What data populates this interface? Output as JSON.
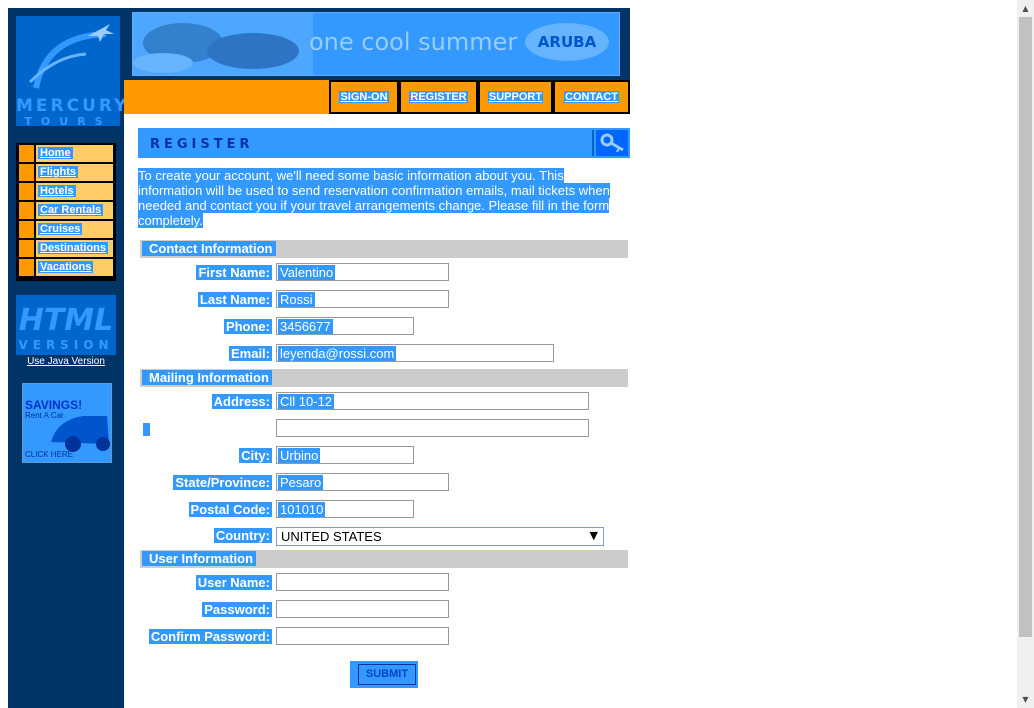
{
  "logo": {
    "line1": "MERCURY",
    "line2": "TOURS"
  },
  "nav": [
    {
      "label": "Home"
    },
    {
      "label": "Flights"
    },
    {
      "label": "Hotels"
    },
    {
      "label": "Car Rentals"
    },
    {
      "label": "Cruises"
    },
    {
      "label": "Destinations"
    },
    {
      "label": "Vacations"
    }
  ],
  "html_version": {
    "big": "HTML",
    "small": "VERSION",
    "link": "Use Java Version"
  },
  "ad": {
    "title": "SAVINGS!",
    "sub": "Rent A Car",
    "cta": "CLICK HERE"
  },
  "banner": {
    "slogan": "one cool summer",
    "brand": "ARUBA"
  },
  "top_nav": [
    {
      "label": "SIGN-ON"
    },
    {
      "label": "REGISTER"
    },
    {
      "label": "SUPPORT"
    },
    {
      "label": "CONTACT"
    }
  ],
  "page_title": "REGISTER",
  "intro": "To create your account, we'll need some basic information about you. This information will be used to send reservation confirmation emails, mail tickets when needed and contact you if your travel arrangements change. Please fill in the form completely.",
  "sections": {
    "contact": "Contact Information",
    "mailing": "Mailing Information",
    "user": "User Information"
  },
  "fields": {
    "first_name": {
      "label": "First Name:",
      "value": "Valentino"
    },
    "last_name": {
      "label": "Last Name:",
      "value": "Rossi"
    },
    "phone": {
      "label": "Phone:",
      "value": "3456677"
    },
    "email": {
      "label": "Email:",
      "value": "leyenda@rossi.com"
    },
    "address": {
      "label": "Address:",
      "value": "Cll 10-12"
    },
    "address2": {
      "value": ""
    },
    "city": {
      "label": "City:",
      "value": "Urbino"
    },
    "state": {
      "label": "State/Province:",
      "value": "Pesaro"
    },
    "postal": {
      "label": "Postal Code:",
      "value": "101010"
    },
    "country": {
      "label": "Country:",
      "value": "UNITED STATES"
    },
    "user_name": {
      "label": "User Name:",
      "value": ""
    },
    "password": {
      "label": "Password:",
      "value": ""
    },
    "confirm_password": {
      "label": "Confirm Password:",
      "value": ""
    }
  },
  "submit_label": "SUBMIT",
  "colors": {
    "navy": "#003366",
    "blue": "#0066cc",
    "highlight": "#3399ff",
    "orange": "#ff9900",
    "gray": "#cccccc"
  }
}
